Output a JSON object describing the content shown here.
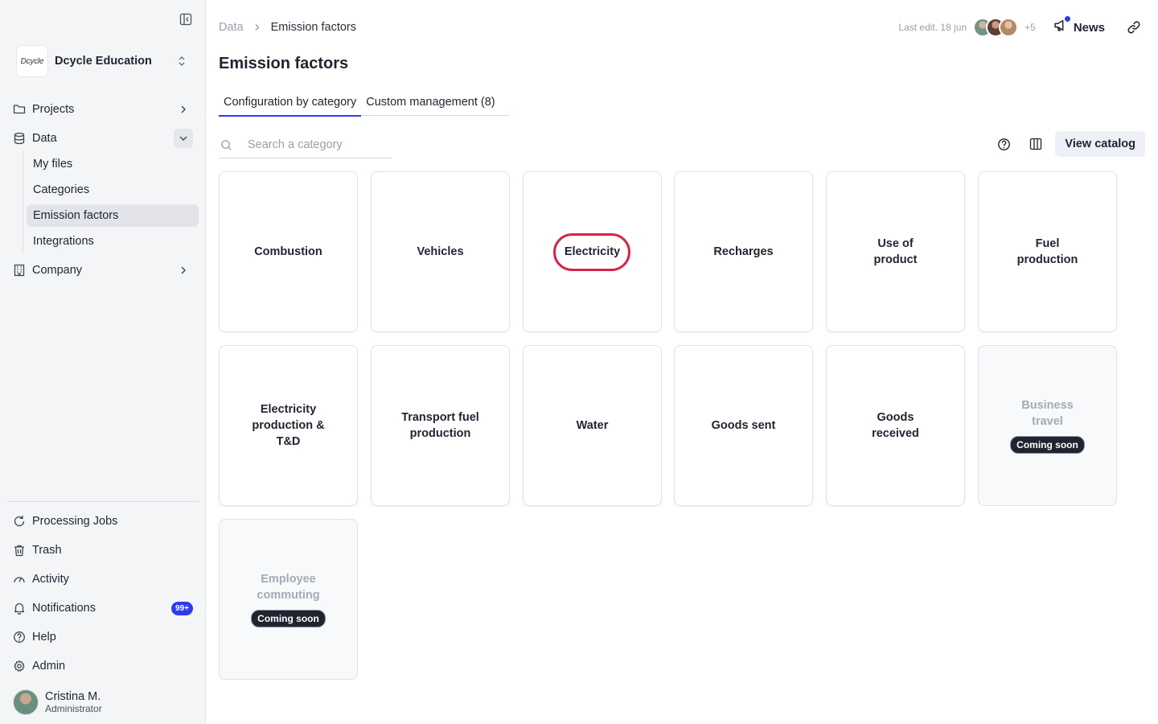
{
  "sidebar": {
    "org_logo_text": "Dcycle",
    "org_name": "Dcycle Education",
    "nav": {
      "projects": "Projects",
      "data": "Data",
      "company": "Company"
    },
    "data_sub": [
      "My files",
      "Categories",
      "Emission factors",
      "Integrations"
    ],
    "bottom": {
      "processing_jobs": "Processing Jobs",
      "trash": "Trash",
      "activity": "Activity",
      "notifications": "Notifications",
      "notifications_badge": "99+",
      "help": "Help",
      "admin": "Admin"
    },
    "user": {
      "name": "Cristina M.",
      "role": "Administrator"
    }
  },
  "header": {
    "breadcrumb": [
      "Data",
      "Emission factors"
    ],
    "last_edit": "Last edit. 18 jun",
    "avatars_more": "+5",
    "news_label": "News"
  },
  "page": {
    "title": "Emission factors",
    "tabs": [
      "Configuration by category",
      "Custom management (8)"
    ],
    "search_placeholder": "Search a category",
    "view_catalog": "View catalog"
  },
  "cards": [
    {
      "label": "Combustion",
      "disabled": false
    },
    {
      "label": "Vehicles",
      "disabled": false
    },
    {
      "label": "Electricity",
      "disabled": false,
      "highlighted": true
    },
    {
      "label": "Recharges",
      "disabled": false
    },
    {
      "label": "Use of product",
      "disabled": false
    },
    {
      "label": "Fuel production",
      "disabled": false
    },
    {
      "label": "Electricity production & T&D",
      "disabled": false
    },
    {
      "label": "Transport fuel production",
      "disabled": false
    },
    {
      "label": "Water",
      "disabled": false
    },
    {
      "label": "Goods sent",
      "disabled": false
    },
    {
      "label": "Goods received",
      "disabled": false
    },
    {
      "label": "Business travel",
      "disabled": true,
      "badge": "Coming soon"
    },
    {
      "label": "Employee commuting",
      "disabled": true,
      "badge": "Coming soon"
    }
  ],
  "colors": {
    "accent": "#2e3bea",
    "highlight": "#d6234a",
    "sidebar_bg": "#f4f5f7"
  }
}
